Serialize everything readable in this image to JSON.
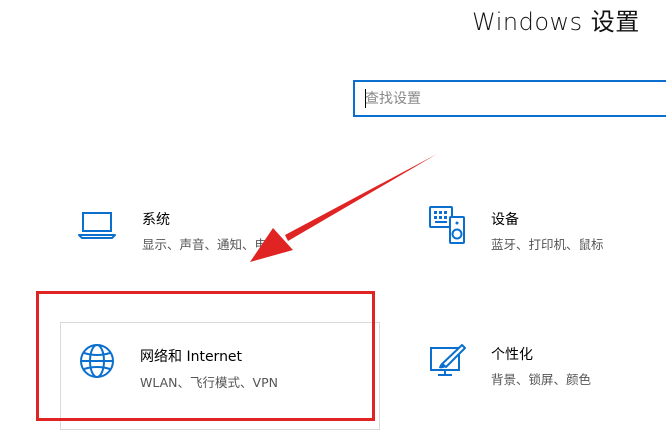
{
  "window": {
    "title": "Windows 设置"
  },
  "search": {
    "placeholder": "查找设置",
    "value": ""
  },
  "tiles": [
    {
      "name": "系统",
      "desc": "显示、声音、通知、电源",
      "icon": "laptop-icon"
    },
    {
      "name": "设备",
      "desc": "蓝牙、打印机、鼠标",
      "icon": "devices-icon"
    },
    {
      "name": "网络和 Internet",
      "desc": "WLAN、飞行模式、VPN",
      "icon": "globe-icon"
    },
    {
      "name": "个性化",
      "desc": "背景、锁屏、颜色",
      "icon": "personalization-icon"
    }
  ],
  "colors": {
    "accent": "#0a6fce",
    "annotation": "#e02424",
    "tile_border": "#dadada"
  }
}
